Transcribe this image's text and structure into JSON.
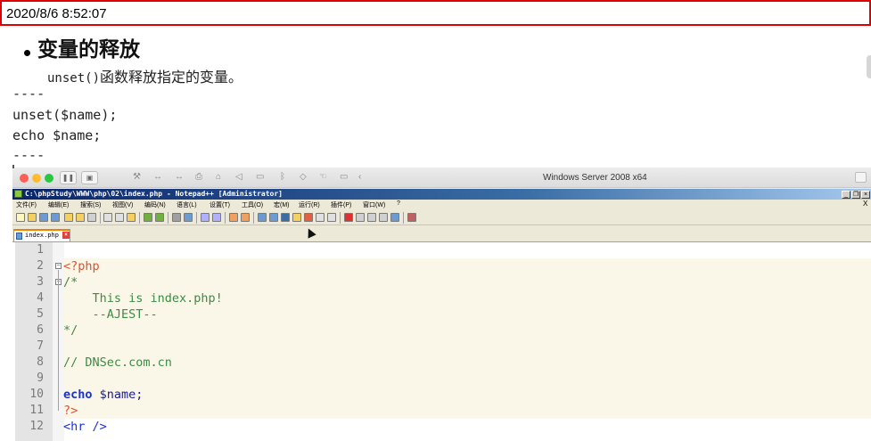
{
  "timestamp": "2020/8/6 8:52:07",
  "slide": {
    "heading": "变量的释放",
    "desc_code": "unset()",
    "desc_text": "函数释放指定的变量。",
    "lines": [
      "----",
      "unset($name);",
      "echo $name;",
      "----"
    ]
  },
  "vm_window": {
    "title": "Windows Server 2008 x64"
  },
  "notepadpp": {
    "title": "C:\\phpStudy\\WWW\\php\\02\\index.php - Notepad++ [Administrator]",
    "menu": [
      "文件(F)",
      "编辑(E)",
      "搜索(S)",
      "视图(V)",
      "编码(N)",
      "语言(L)",
      "设置(T)",
      "工具(O)",
      "宏(M)",
      "运行(R)",
      "插件(P)",
      "窗口(W)",
      "?"
    ],
    "menu_close": "X",
    "tab_label": "index.php",
    "code_lines": [
      {
        "num": "1",
        "parts": []
      },
      {
        "num": "2",
        "parts": [
          {
            "t": "<?php",
            "c": "tag"
          }
        ]
      },
      {
        "num": "3",
        "parts": [
          {
            "t": "/*",
            "c": "com"
          }
        ]
      },
      {
        "num": "4",
        "parts": [
          {
            "t": "    This is index.php!",
            "c": "com"
          }
        ]
      },
      {
        "num": "5",
        "parts": [
          {
            "t": "    --AJEST--",
            "c": "com"
          }
        ]
      },
      {
        "num": "6",
        "parts": [
          {
            "t": "*/",
            "c": "com"
          }
        ]
      },
      {
        "num": "7",
        "parts": []
      },
      {
        "num": "8",
        "parts": [
          {
            "t": "// DNSec.com.cn",
            "c": "com"
          }
        ]
      },
      {
        "num": "9",
        "parts": []
      },
      {
        "num": "10",
        "parts": [
          {
            "t": "echo",
            "c": "kw"
          },
          {
            "t": " $name;",
            "c": "var"
          }
        ]
      },
      {
        "num": "11",
        "parts": [
          {
            "t": "?>",
            "c": "tag"
          }
        ]
      },
      {
        "num": "12",
        "parts": [
          {
            "t": "<hr />",
            "c": "html"
          }
        ]
      }
    ]
  }
}
